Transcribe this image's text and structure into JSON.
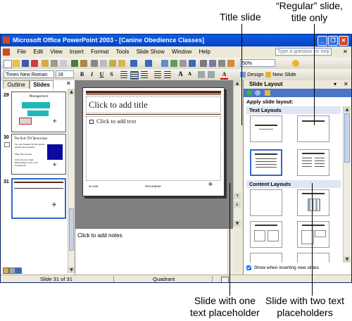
{
  "callouts": {
    "title_slide": "Title slide",
    "regular_line1": "“Regular” slide,",
    "regular_line2": "title only",
    "one_text_line1": "Slide with one",
    "one_text_line2": "text placeholder",
    "two_text_line1": "Slide with two text",
    "two_text_line2": "placeholders"
  },
  "window": {
    "title": "Microsoft Office PowerPoint 2003 - [Canine Obedience Classes]",
    "controls": {
      "minimize": "_",
      "restore": "❐",
      "close": "✕"
    }
  },
  "menubar": {
    "items": [
      "File",
      "Edit",
      "View",
      "Insert",
      "Format",
      "Tools",
      "Slide Show",
      "Window",
      "Help"
    ],
    "help_box_placeholder": "Type a question for help"
  },
  "toolbar": {
    "zoom": "50%",
    "font": "Times New Roman",
    "size": "18",
    "bold": "B",
    "italic": "I",
    "underline": "U",
    "shadow": "S",
    "grow_font": "A",
    "shrink_font": "A",
    "font_color": "A",
    "design": "Design",
    "new_slide": "New Slide"
  },
  "left_pane": {
    "tabs": [
      "Outline",
      "Slides"
    ],
    "close": "✕",
    "slides": [
      {
        "number": "29",
        "title": "Management"
      },
      {
        "number": "30",
        "title": "The End (Till Tomorrow)",
        "bullets": [
          "You are headed to the great places we've been!",
          "Stay the Course",
          "Look at your dog! Remember to do your homework"
        ]
      },
      {
        "number": "31"
      }
    ]
  },
  "slide": {
    "title_placeholder": "Click to add title",
    "text_placeholder": "Click to add text",
    "footer_left": "W-2008",
    "footer_center": "PRELIMINARY"
  },
  "notes": {
    "placeholder": "Click to add notes"
  },
  "task_pane": {
    "title": "Slide Layout",
    "apply_label": "Apply slide layout:",
    "section_text": "Text Layouts",
    "section_content": "Content Layouts",
    "checkbox_label": "Show when inserting new slides",
    "checkbox_checked": true
  },
  "status": {
    "slide_info": "Slide 31 of 31",
    "design": "Quadrant"
  },
  "colors": {
    "title_bar": "#0a5ee8",
    "slide_band": "#5a2a12",
    "thumb_selected": "#316ac5",
    "taskpane_header": "#dde6f5"
  }
}
